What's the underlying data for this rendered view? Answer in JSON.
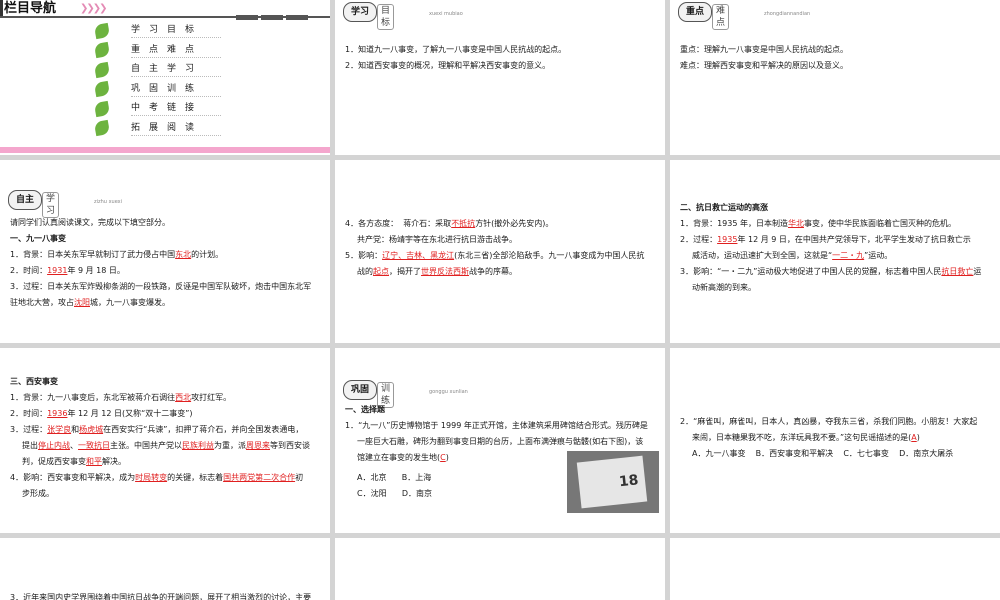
{
  "nav": {
    "title": "栏目导航",
    "items": [
      "学习目标",
      "重点难点",
      "自主学习",
      "巩固训练",
      "中考链接",
      "拓展阅读"
    ]
  },
  "s2": {
    "badge": "学习",
    "sub": "目标",
    "pinyin": "xuexi mubiao",
    "lines": [
      "1．知道九一八事变，了解九一八事变是中国人民抗战的起点。",
      "2．知道西安事变的概况，理解和平解决西安事变的意义。"
    ]
  },
  "s3": {
    "badge": "重点",
    "sub": "难点",
    "pinyin": "zhongdiannandian",
    "lines": [
      "重点：理解九一八事变是中国人民抗战的起点。",
      "难点：理解西安事变和平解决的原因以及意义。"
    ]
  },
  "s4": {
    "badge": "自主",
    "sub": "学习",
    "pinyin": "zizhu xuexi",
    "intro": "请同学们认真阅读课文，完成以下填空部分。",
    "h1": "一、九一八事变",
    "l1a": "1．背景：日本关东军早就制订了武力侵占中国",
    "l1r": "东北",
    "l1b": "的计划。",
    "l2a": "2．时间：",
    "l2r": "1931",
    "l2b": "年 9 月 18 日。",
    "l3": "3．过程：日本关东军炸毁柳条湖的一段铁路，反诬是中国军队破坏，炮击中国东北军",
    "l4a": "驻地北大营，攻占",
    "l4r": "沈阳",
    "l4b": "城，九一八事变爆发。"
  },
  "s5": {
    "l1a": "4．各方态度：",
    "l1b": "蒋介石：采取",
    "l1r": "不抵抗",
    "l1c": "方针(撤外必先安内)。",
    "l2": "共产党：杨靖宇等在东北进行抗日游击战争。",
    "l3a": "5．影响：",
    "l3r": "辽宁、吉林、黑龙江",
    "l3b": "(东北三省)全部沦陷敌手。九一八事变成为中国人民抗",
    "l4a": "战的",
    "l4r": "起点",
    "l4b": "，揭开了",
    "l4r2": "世界反法西斯",
    "l4c": "战争的序幕。"
  },
  "s6": {
    "h": "二、抗日救亡运动的高涨",
    "l1a": "1．背景：1935 年，日本制造",
    "l1r": "华北",
    "l1b": "事变，使中华民族面临着亡国灭种的危机。",
    "l2a": "2．过程：",
    "l2r": "1935",
    "l2b": "年 12 月 9 日，在中国共产党领导下，北平学生发动了抗日救亡示",
    "l3a": "威活动，运动迅速扩大到全国，这就是“",
    "l3r": "一二・九",
    "l3b": "”运动。",
    "l4a": "3．影响：“一・二九”运动极大地促进了中国人民的觉醒，标志着中国人民",
    "l4r": "抗日救亡",
    "l4b": "运",
    "l5": "动新高潮的到来。"
  },
  "s7": {
    "h": "三、西安事变",
    "l1a": "1．背景：九一八事变后，东北军被蒋介石调往",
    "l1r": "西北",
    "l1b": "攻打红军。",
    "l2a": "2．时间：",
    "l2r": "1936",
    "l2b": "年 12 月 12 日(又称“双十二事变”)",
    "l3a": "3．过程：",
    "l3r": "张学良",
    "l3b": "和",
    "l3r2": "杨虎城",
    "l3c": "在西安实行“兵谏”，扣押了蒋介石，并向全国发表通电，",
    "l4a": "提出",
    "l4r": "停止内战",
    "l4b": "、",
    "l4r2": "一致抗日",
    "l4c": "主张。中国共产党以",
    "l4r3": "民族利益",
    "l4d": "为重，派",
    "l4r4": "周恩来",
    "l4e": "等到西安谈",
    "l5a": "判，促成西安事变",
    "l5r": "和平",
    "l5b": "解决。",
    "l6a": "4．影响：西安事变和平解决，成为",
    "l6r": "时局转变",
    "l6b": "的关键，标志着",
    "l6r2": "国共两党第二次合作",
    "l6c": "初",
    "l7": "步形成。"
  },
  "s8": {
    "badge": "巩固",
    "sub": "训练",
    "pinyin": "gonggu xunlian",
    "h": "一、选择题",
    "q1": "1．“九一八”历史博物馆于 1999 年正式开馆，主体建筑采用碑馆结合形式。残历碑是",
    "q2": "一座巨大石雕，碑形为翻到事变日期的台历，上面布满弹痕与骷髅(如右下图)，该",
    "q3a": "馆建立在事变的发生地(",
    "q3r": "C",
    "q3b": ")",
    "oA": "A．北京",
    "oB": "B．上海",
    "oC": "C．沈阳",
    "oD": "D．南京",
    "photo_text": "18"
  },
  "s9": {
    "q1": "2．“麻雀叫，麻雀叫，日本人，真凶暴，夺我东三省，杀我们同胞。小朋友！大家起",
    "q2a": "来闹，日本糖果我不吃，东洋玩具我不要。”这句民谣描述的是(",
    "q2r": "A",
    "q2b": ")",
    "oA": "A．九一八事变",
    "oB": "B．西安事变和平解决",
    "oC": "C．七七事变",
    "oD": "D．南京大屠杀"
  },
  "s10": {
    "q": "3．近年来国内史学界围绕着中国抗日战争的开端问题，展开了相当激烈的讨论，主要"
  }
}
